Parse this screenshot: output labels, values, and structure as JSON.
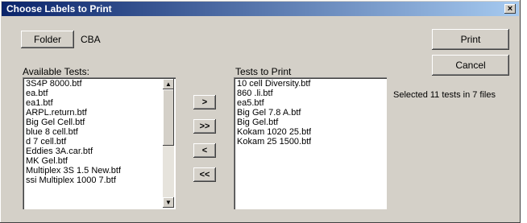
{
  "window": {
    "title": "Choose Labels to Print",
    "close_glyph": "×"
  },
  "folder": {
    "button_label": "Folder",
    "value": "CBA"
  },
  "available": {
    "label": "Available Tests:",
    "items": [
      "3S4P 8000.btf",
      "ea.btf",
      "ea1.btf",
      "ARPL.return.btf",
      "Big Gel Cell.btf",
      "blue 8 cell.btf",
      "d 7 cell.btf",
      "Eddies 3A.car.btf",
      "MK Gel.btf",
      "Multiplex 3S 1.5 New.btf",
      "ssi Multiplex 1000 7.btf"
    ]
  },
  "to_print": {
    "label": "Tests to Print",
    "items": [
      "10 cell Diversity.btf",
      "860 .li.btf",
      "ea5.btf",
      "Big Gel 7.8 A.btf",
      "Big Gel.btf",
      "Kokam 1020 25.btf",
      "Kokam 25 1500.btf"
    ]
  },
  "move_buttons": {
    "add": ">",
    "add_all": ">>",
    "remove": "<",
    "remove_all": "<<"
  },
  "actions": {
    "print": "Print",
    "cancel": "Cancel"
  },
  "status": "Selected 11 tests in 7 files",
  "icons": {
    "scroll_up": "up-arrow",
    "scroll_down": "down-arrow",
    "close": "close-x"
  }
}
